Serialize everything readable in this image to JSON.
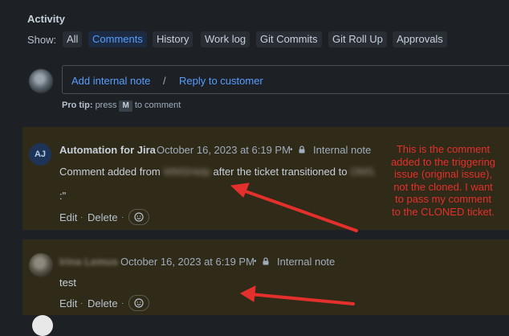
{
  "activity": {
    "title": "Activity",
    "show_label": "Show:",
    "filters": [
      {
        "label": "All",
        "active": false
      },
      {
        "label": "Comments",
        "active": true
      },
      {
        "label": "History",
        "active": false
      },
      {
        "label": "Work log",
        "active": false
      },
      {
        "label": "Git Commits",
        "active": false
      },
      {
        "label": "Git Roll Up",
        "active": false
      },
      {
        "label": "Approvals",
        "active": false
      }
    ]
  },
  "composer": {
    "internal_note": "Add internal note",
    "separator": "/",
    "reply": "Reply to customer",
    "protip_bold": "Pro tip:",
    "protip_press": "press",
    "protip_key": "M",
    "protip_end": "to comment"
  },
  "comments": [
    {
      "avatar_initials": "AJ",
      "author": "Automation for Jira",
      "timestamp": "October 16, 2023 at 6:19 PM",
      "visibility": "Internal note",
      "text_before": "Comment added from",
      "text_redacted_1": "WMSHelp",
      "text_middle": "after the ticket transitioned to",
      "text_redacted_2": "OMS.",
      "text_line2": ":\"",
      "edit": "Edit",
      "delete": "Delete"
    },
    {
      "author": "Irina Lemus",
      "timestamp": "October 16, 2023 at 6:19 PM",
      "visibility": "Internal note",
      "text": "test",
      "edit": "Edit",
      "delete": "Delete"
    }
  ],
  "annotation": {
    "text": "This is the comment added to the triggering issue (original issue), not the cloned. I want to pass my comment to the CLONED ticket.",
    "color": "#e4302c"
  },
  "colors": {
    "background": "#1d2125",
    "comment_highlight": "#302a18",
    "link": "#579dff",
    "arrow": "#e4302c"
  }
}
